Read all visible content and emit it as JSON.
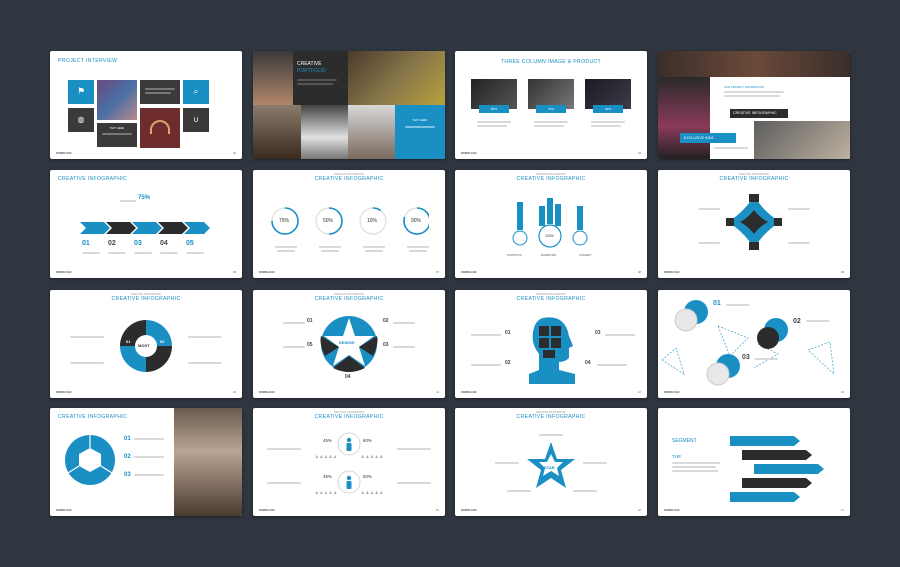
{
  "colors": {
    "accent": "#1a8fc4",
    "dark": "#3a3a3a",
    "background": "#2f3640"
  },
  "footer": {
    "brand": "DOWNLOAD",
    "page_numbers": [
      "02",
      "03",
      "04",
      "05",
      "06",
      "07",
      "08",
      "09",
      "10",
      "11",
      "12",
      "13",
      "14",
      "15",
      "16",
      "17"
    ]
  },
  "slides": {
    "s1": {
      "title": "PROJECT INTERVIEW",
      "caption": "TEXT HERE"
    },
    "s2": {
      "title_line1": "CREATIVE",
      "title_line2": "PORTFOLIO",
      "caption": "TEXT HERE"
    },
    "s3": {
      "title": "THREE COLUMN IMAGE & PRODUCT",
      "badges": [
        "80%",
        "70%",
        "90%"
      ]
    },
    "s4": {
      "heading": "OUR PROJECT INFORMATION",
      "title": "CREATIVE INFOGRAPHIC",
      "tag": "EXCLUSIVE IDEA"
    },
    "s5": {
      "title": "CREATIVE INFOGRAPHIC",
      "percent": "75%",
      "steps": [
        "01",
        "02",
        "03",
        "04",
        "05"
      ]
    },
    "s6": {
      "title": "CREATIVE INFOGRAPHIC",
      "circles": [
        "75%",
        "50%",
        "10%",
        "90%"
      ]
    },
    "s7": {
      "title": "CREATIVE INFOGRAPHIC",
      "center": "100%",
      "labels": [
        "STATISTICS",
        "MARKETING",
        "CONCEPT"
      ]
    },
    "s8": {
      "title": "CREATIVE INFOGRAPHIC"
    },
    "s9": {
      "title": "CREATIVE INFOGRAPHIC",
      "center": "MOST",
      "steps": [
        "01",
        "02",
        "03",
        "04"
      ]
    },
    "s10": {
      "title": "CREATIVE INFOGRAPHIC",
      "center": "DESIGN",
      "steps": [
        "01",
        "02",
        "03",
        "04",
        "05"
      ]
    },
    "s11": {
      "title": "CREATIVE INFOGRAPHIC",
      "steps": [
        "01",
        "02",
        "03",
        "04"
      ]
    },
    "s12": {
      "steps": [
        "01",
        "02",
        "03"
      ]
    },
    "s13": {
      "title": "CREATIVE INFOGRAPHIC",
      "steps": [
        "01",
        "02",
        "03"
      ]
    },
    "s14": {
      "title": "CREATIVE INFOGRAPHIC",
      "percents": [
        "45%",
        "60%",
        "45%",
        "60%"
      ]
    },
    "s15": {
      "title": "CREATIVE INFOGRAPHIC",
      "center": "STAR"
    },
    "s16": {
      "subtitle": "SEGMENT",
      "heading": "THE"
    }
  }
}
